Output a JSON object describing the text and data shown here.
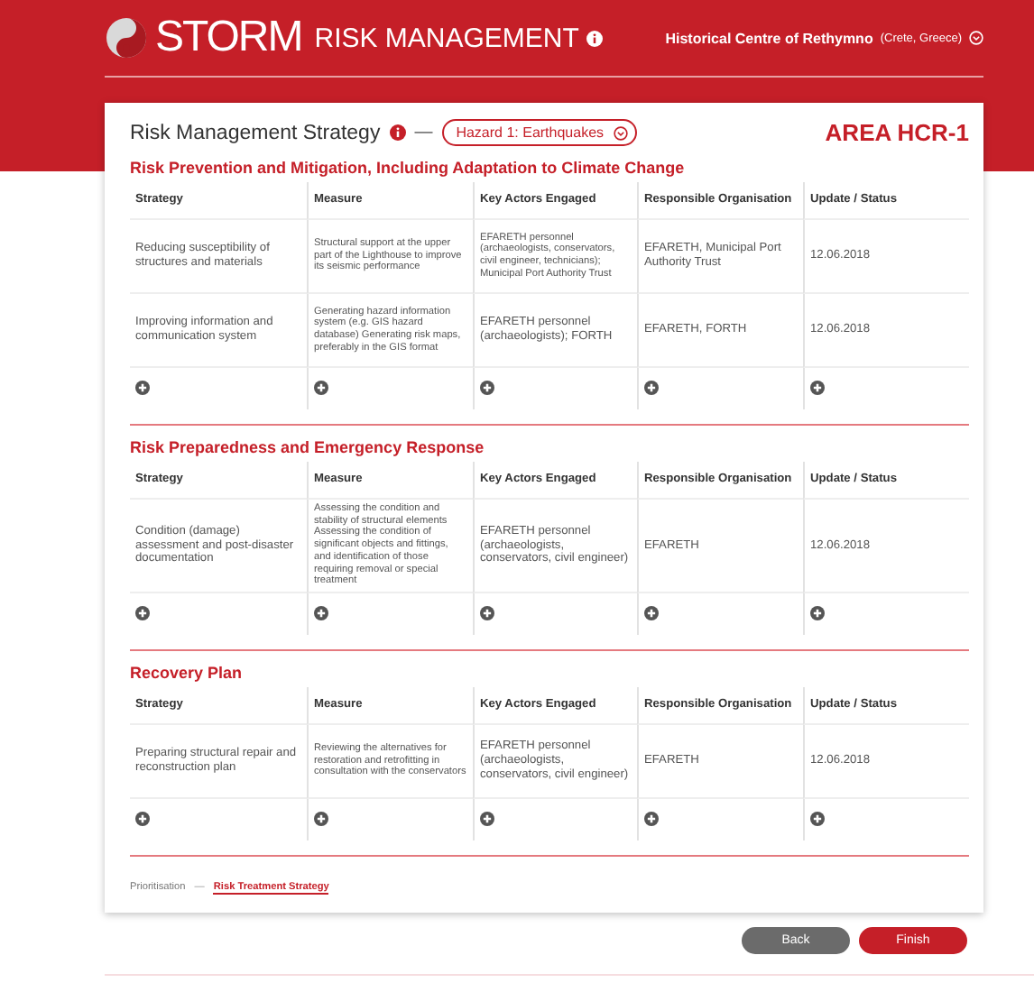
{
  "header": {
    "brand": "STORM",
    "product": "RISK MANAGEMENT",
    "site": "Historical Centre of Rethymno",
    "site_detail": "(Crete, Greece)"
  },
  "card": {
    "title": "Risk Management Strategy",
    "separator": "—",
    "hazard": "Hazard 1: Earthquakes",
    "area": "AREA HCR-1"
  },
  "sections": [
    {
      "title": "Risk Prevention and Mitigation, Including Adaptation to Climate Change",
      "columns": [
        "Strategy",
        "Measure",
        "Key Actors Engaged",
        "Responsible Organisation",
        "Update / Status"
      ],
      "rows": [
        [
          "Reducing susceptibility of structures and materials",
          "Structural support at the upper part of the Lighthouse to improve its seismic performance",
          "EFARETH personnel (archaeologists, conservators, civil engineer, technicians); Municipal Port Authority Trust",
          "EFARETH, Municipal Port Authority Trust",
          "12.06.2018"
        ],
        [
          "Improving information and communication system",
          "Generating hazard information system (e.g. GIS hazard database) Generating risk maps, preferably in the GIS format",
          "EFARETH personnel (archaeologists); FORTH",
          "EFARETH, FORTH",
          "12.06.2018"
        ]
      ]
    },
    {
      "title": "Risk Preparedness and Emergency Response",
      "columns": [
        "Strategy",
        "Measure",
        "Key Actors Engaged",
        "Responsible Organisation",
        "Update / Status"
      ],
      "rows": [
        [
          "Condition (damage) assessment and post-disaster documentation",
          "Assessing the condition and stability of structural elements Assessing the condition of significant objects and fittings, and identification of those requiring removal or special treatment",
          "EFARETH personnel (archaeologists, conservators, civil engineer)",
          "EFARETH",
          "12.06.2018"
        ]
      ]
    },
    {
      "title": "Recovery Plan",
      "columns": [
        "Strategy",
        "Measure",
        "Key Actors Engaged",
        "Responsible Organisation",
        "Update / Status"
      ],
      "rows": [
        [
          "Preparing structural repair and reconstruction plan",
          "Reviewing the alternatives for restoration and retrofitting in consultation with the conservators",
          "EFARETH personnel (archaeologists, conservators, civil engineer)",
          "EFARETH",
          "12.06.2018"
        ]
      ]
    }
  ],
  "breadcrumb": {
    "separator": "—",
    "items": [
      {
        "label": "Prioritisation",
        "selected": false
      },
      {
        "label": "Risk Treatment Strategy",
        "selected": true
      }
    ]
  },
  "buttons": [
    {
      "label": "Back",
      "kind": "secondary"
    },
    {
      "label": "Finish",
      "kind": "primary"
    }
  ]
}
